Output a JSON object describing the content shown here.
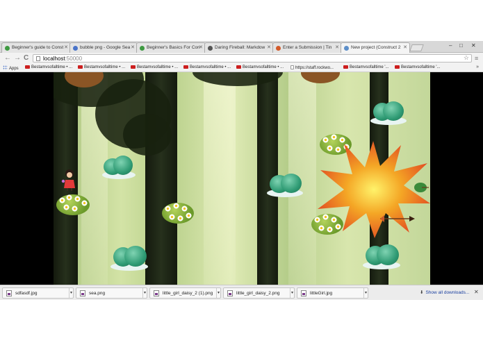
{
  "tabs": [
    {
      "title": "Beginner's guide to Const",
      "icon_color": "#3f9a42"
    },
    {
      "title": "bubble png - Google Sea",
      "icon_color": "#4a74c9"
    },
    {
      "title": "Beginner's Basics For Con",
      "icon_color": "#3f9a42"
    },
    {
      "title": "Daring Fireball: Markdow",
      "icon_color": "#555555"
    },
    {
      "title": "Enter a Submission | Tin",
      "icon_color": "#d35a2a"
    },
    {
      "title": "New project (Construct 2",
      "icon_color": "#5d8fc9",
      "active": true
    }
  ],
  "window": {
    "minimize": "–",
    "maximize": "□",
    "close": "✕"
  },
  "nav": {
    "back": "←",
    "forward": "→",
    "reload": "C"
  },
  "omnibox": {
    "host": "localhost",
    "port": ":50000",
    "star": "☆"
  },
  "menu_icon": "≡",
  "bookmarks": [
    {
      "label": "Apps",
      "icon": "apps-icon"
    },
    {
      "label": "Bestamvsofalltime • ...",
      "icon": "youtube-icon"
    },
    {
      "label": "Bestamvsofalltime • ...",
      "icon": "youtube-icon"
    },
    {
      "label": "Bestamvsofalltime • ...",
      "icon": "youtube-icon"
    },
    {
      "label": "Bestamvsofalltime • ...",
      "icon": "youtube-icon"
    },
    {
      "label": "Bestamvsofalltime • ...",
      "icon": "youtube-icon"
    },
    {
      "label": "https://staff.rockwo...",
      "icon": "page-icon"
    },
    {
      "label": "Bestamvsofalltime '...",
      "icon": "youtube-icon"
    },
    {
      "label": "Bestamvsofalltime '...",
      "icon": "youtube-icon"
    }
  ],
  "bookmarks_more": "»",
  "downloads": [
    {
      "name": "sdfasdf.jpg",
      "menu": "▾"
    },
    {
      "name": "sea.png",
      "menu": "▾"
    },
    {
      "name": "little_girl_daisy_2 (1).png",
      "menu": "▾"
    },
    {
      "name": "little_girl_daisy_2.png",
      "menu": "▾"
    },
    {
      "name": "littleGirl.jpg",
      "menu": "▾"
    }
  ],
  "show_all": "Show all downloads...",
  "shelf_close": "✕",
  "game": {
    "background_color": "#c7dc9c",
    "sprites": [
      "girl",
      "bush",
      "daisy-bush",
      "explosion",
      "arrow",
      "owl"
    ]
  }
}
